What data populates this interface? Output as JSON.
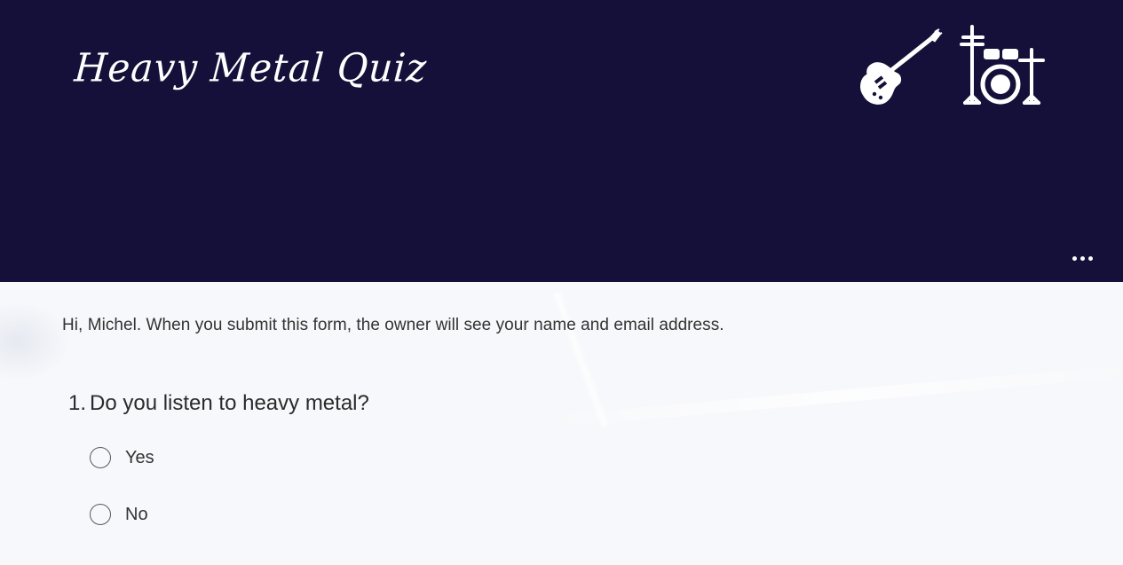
{
  "header": {
    "title": "Heavy Metal Quiz",
    "background_color": "#15103a",
    "icons": [
      "electric-guitar-icon",
      "drum-kit-icon"
    ],
    "more_icon": "more-horizontal-icon"
  },
  "form": {
    "notice": "Hi, Michel. When you submit this form, the owner will see your name and email address.",
    "questions": [
      {
        "number": "1.",
        "text": "Do you listen to heavy metal?",
        "options": [
          {
            "label": "Yes",
            "selected": false
          },
          {
            "label": "No",
            "selected": false
          }
        ]
      }
    ]
  }
}
